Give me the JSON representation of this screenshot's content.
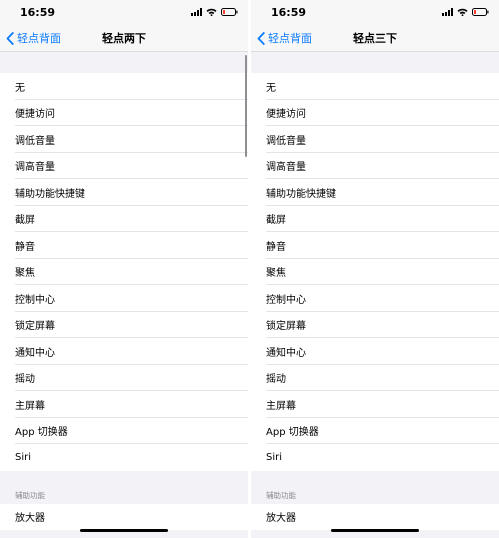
{
  "screens": [
    {
      "status": {
        "time": "16:59"
      },
      "nav": {
        "back_label": "轻点背面",
        "title": "轻点两下"
      },
      "items": [
        "无",
        "便捷访问",
        "调低音量",
        "调高音量",
        "辅助功能快捷键",
        "截屏",
        "静音",
        "聚焦",
        "控制中心",
        "锁定屏幕",
        "通知中心",
        "摇动",
        "主屏幕",
        "App 切换器",
        "Siri"
      ],
      "section_header": "辅助功能",
      "section_items": [
        "放大器"
      ]
    },
    {
      "status": {
        "time": "16:59"
      },
      "nav": {
        "back_label": "轻点背面",
        "title": "轻点三下"
      },
      "items": [
        "无",
        "便捷访问",
        "调低音量",
        "调高音量",
        "辅助功能快捷键",
        "截屏",
        "静音",
        "聚焦",
        "控制中心",
        "锁定屏幕",
        "通知中心",
        "摇动",
        "主屏幕",
        "App 切换器",
        "Siri"
      ],
      "section_header": "辅助功能",
      "section_items": [
        "放大器"
      ]
    }
  ],
  "colors": {
    "accent": "#0a7aff",
    "battery_low": "#ff3b30",
    "background": "#f2f2f7",
    "separator": "#e4e4e6",
    "section_header": "#8a8a8e"
  },
  "icons": [
    "signal-icon",
    "wifi-icon",
    "battery-icon",
    "chevron-left-icon"
  ]
}
